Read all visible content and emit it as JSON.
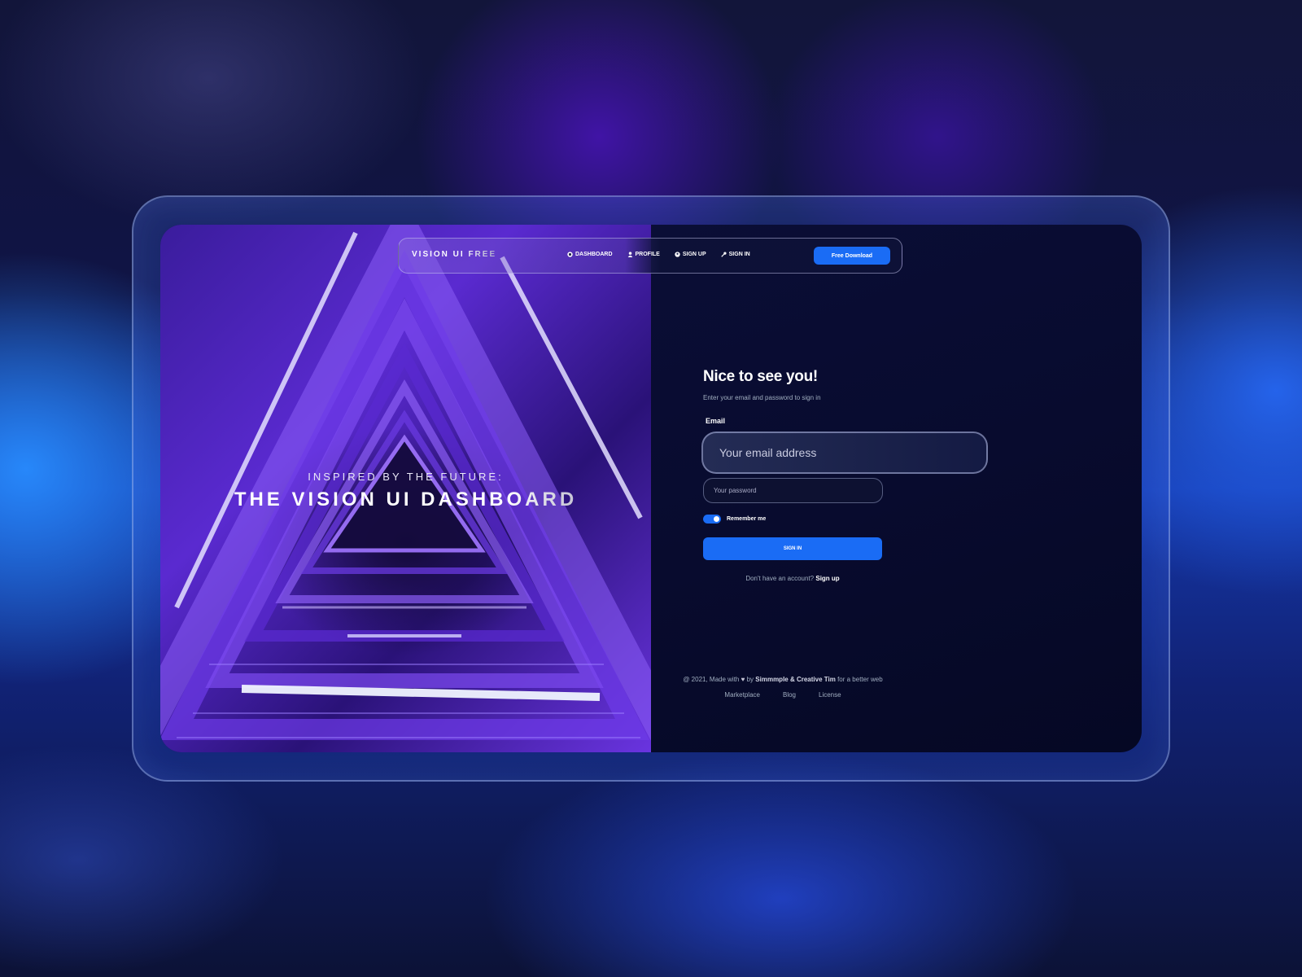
{
  "hero": {
    "eyebrow": "INSPIRED BY THE FUTURE:",
    "title": "THE VISION UI DASHBOARD"
  },
  "navbar": {
    "brand": "VISION UI FREE",
    "links": [
      {
        "label": "DASHBOARD",
        "icon": "dashboard-icon"
      },
      {
        "label": "PROFILE",
        "icon": "user-icon"
      },
      {
        "label": "SIGN UP",
        "icon": "circle-user-icon"
      },
      {
        "label": "SIGN IN",
        "icon": "key-icon"
      }
    ],
    "download_label": "Free Download"
  },
  "form": {
    "title": "Nice to see you!",
    "subtitle": "Enter your email and password to sign in",
    "email_label": "Email",
    "email_placeholder": "Your email address",
    "password_placeholder": "Your password",
    "remember_label": "Remember me",
    "remember_on": true,
    "signin_label": "SIGN IN",
    "no_account_text": "Don't have an account?",
    "signup_link": "Sign up"
  },
  "footer": {
    "copyright_prefix": "@ 2021, Made with",
    "by_text": "by",
    "authors": "Simmmple & Creative Tim",
    "suffix": "for a better web",
    "links": [
      "Marketplace",
      "Blog",
      "License"
    ]
  },
  "colors": {
    "accent": "#1a6cf5",
    "muted_text": "#a0aec0"
  }
}
